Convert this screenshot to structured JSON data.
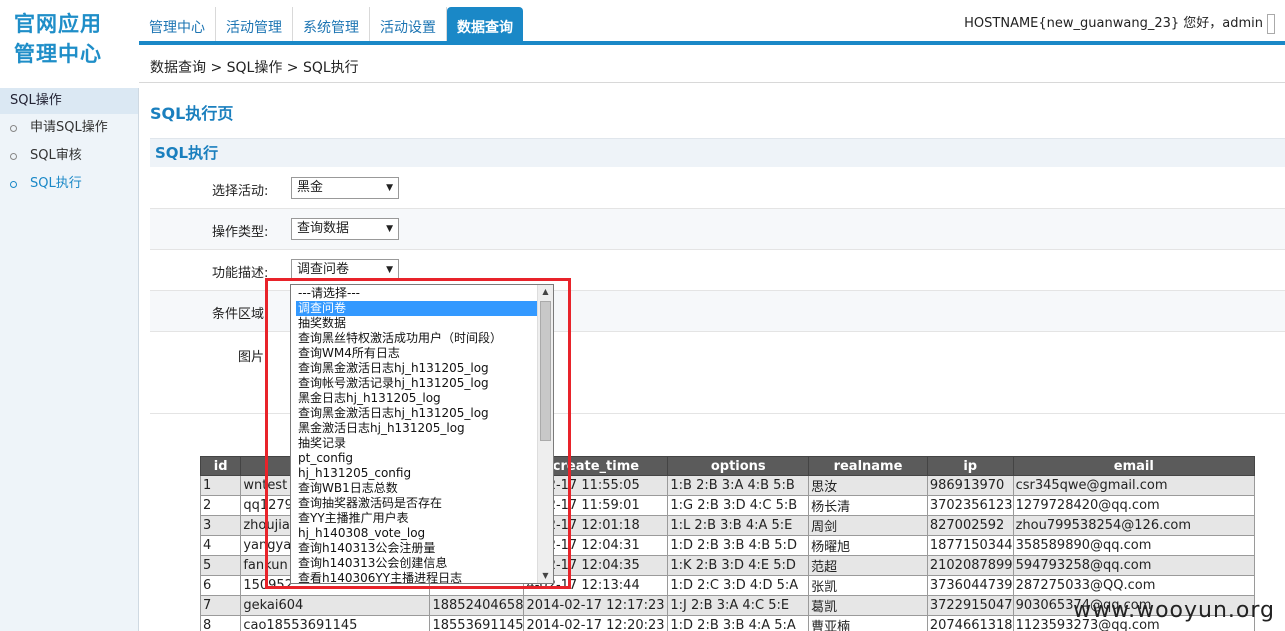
{
  "logo": {
    "line1": "官网应用",
    "line2": "管理中心"
  },
  "nav": {
    "tabs": [
      "管理中心",
      "活动管理",
      "系统管理",
      "活动设置",
      "数据查询"
    ],
    "active": 4
  },
  "greeting": "HOSTNAME{new_guanwang_23} 您好，admin",
  "breadcrumb": "数据查询 > SQL操作 > SQL执行",
  "sidebar": {
    "head": "SQL操作",
    "items": [
      "申请SQL操作",
      "SQL审核",
      "SQL执行"
    ],
    "active": 2
  },
  "page_title": "SQL执行页",
  "section_title": "SQL执行",
  "form": {
    "activity_label": "选择活动:",
    "activity_value": "黑金",
    "optype_label": "操作类型:",
    "optype_value": "查询数据",
    "desc_label": "功能描述:",
    "desc_value": "调查问卷",
    "cond_label": "条件区域",
    "img_label": "图片"
  },
  "dropdown": {
    "options": [
      "---请选择---",
      "调查问卷",
      "抽奖数据",
      "查询黑丝特权激活成功用户（时间段）",
      "查询WM4所有日志",
      "查询黑金激活日志hj_h131205_log",
      "查询帐号激活记录hj_h131205_log",
      "黑金日志hj_h131205_log",
      "查询黑金激活日志hj_h131205_log",
      "黑金激活日志hj_h131205_log",
      "抽奖记录",
      "pt_config",
      "hj_h131205_config",
      "查询WB1日志总数",
      "查询抽奖器激活码是否存在",
      "查YY主播推广用户表",
      "hj_h140308_vote_log",
      "查询h140313公会注册量",
      "查询h140313公会创建信息",
      "查看h140306YY主播进程日志"
    ],
    "selected": 1
  },
  "table": {
    "headers": [
      "id",
      "",
      "",
      "create_time",
      "options",
      "realname",
      "ip",
      "email"
    ],
    "rows": [
      [
        "1",
        "wntest",
        "",
        "4-02-17 11:55:05",
        "1:B 2:B 3:A 4:B 5:B",
        "思汝",
        "986913970",
        "csr345qwe@gmail.com"
      ],
      [
        "2",
        "qq1279",
        "",
        "4-02-17 11:59:01",
        "1:G 2:B 3:D 4:C 5:B",
        "杨长清",
        "3702356123",
        "1279728420@qq.com"
      ],
      [
        "3",
        "zhoujia",
        "",
        "4-02-17 12:01:18",
        "1:L 2:B 3:B 4:A 5:E",
        "周剑",
        "827002592",
        "zhou799538254@126.com"
      ],
      [
        "4",
        "yangya",
        "",
        "4-02-17 12:04:31",
        "1:D 2:B 3:B 4:B 5:D",
        "杨曜旭",
        "1877150344",
        "358589890@qq.com"
      ],
      [
        "5",
        "fankun",
        "",
        "4-02-17 12:04:35",
        "1:K 2:B 3:D 4:E 5:D",
        "范超",
        "2102087899",
        "594793258@qq.com"
      ],
      [
        "6",
        "150952",
        "",
        "4-02-17 12:13:44",
        "1:D 2:C 3:D 4:D 5:A",
        "张凯",
        "3736044739",
        "287275033@QQ.com"
      ],
      [
        "7",
        "gekai604",
        "18852404658",
        "2014-02-17 12:17:23",
        "1:J 2:B 3:A 4:C 5:E",
        "葛凯",
        "3722915047",
        "903065374@qq.com"
      ],
      [
        "8",
        "cao18553691145",
        "18553691145",
        "2014-02-17 12:20:23",
        "1:D 2:B 3:B 4:A 5:A",
        "曹亚楠",
        "2074661318",
        "1123593273@qq.com"
      ]
    ]
  },
  "watermark": "www.wooyun.org"
}
